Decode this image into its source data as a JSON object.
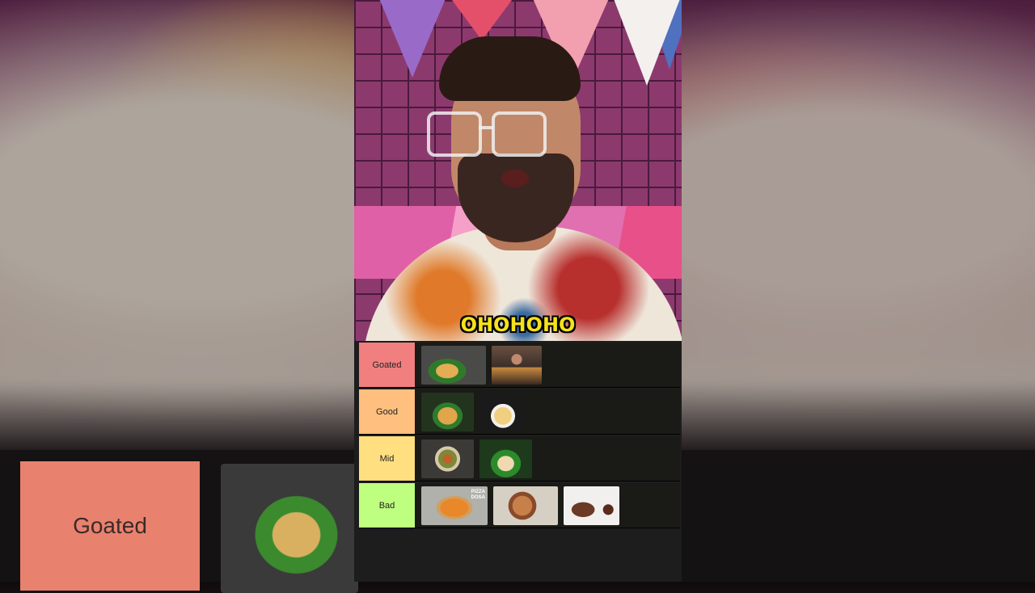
{
  "caption": "OHOHOHO",
  "background": {
    "tier_label": "Goated"
  },
  "tiers": [
    {
      "label": "Goated",
      "color": "#f27f7f",
      "items": [
        {
          "name": "masala-dosa-thumb",
          "width": 80,
          "bg": "radial-gradient(ellipse at 40% 65%, #e3ad54 0 20%, #2f7a2a 21% 34%, #4a4a48 35% 100%)"
        },
        {
          "name": "person-cooking-thumb",
          "width": 62,
          "bg": "radial-gradient(circle at 50% 35%, #c08a70 0 14%, transparent 16%), linear-gradient(180deg,#6a5040 0%, #3a2e28 55%, #c88a40 56%, #3a2a20 100%)"
        }
      ]
    },
    {
      "label": "Good",
      "color": "#ffbf7f",
      "items": [
        {
          "name": "dosa-chutney-thumb",
          "width": 65,
          "bg": "radial-gradient(ellipse at 50% 60%, #e1a54a 0 26%, #2e7b2c 27% 40%, #23341e 41% 100%)"
        },
        {
          "name": "cheese-dosa-thumb",
          "width": 58,
          "bg": "radial-gradient(ellipse at 50% 60%, #f0d080 0 26%, #f4f0e8 27% 36%, #1a1a1a 37% 100%)"
        }
      ]
    },
    {
      "label": "Mid",
      "color": "#ffdf7f",
      "items": [
        {
          "name": "loaded-dosa-thumb",
          "width": 65,
          "bg": "radial-gradient(circle at 50% 50%, #c0602a 0 14%, #7a8a3a 15% 28%, #d8c8a8 29% 38%, #3c3a36 39% 100%)"
        },
        {
          "name": "uttapam-leaf-thumb",
          "width": 65,
          "bg": "radial-gradient(ellipse at 50% 62%, #f0d8b0 0 22%, #2d8a2a 23% 40%, #1e3a1c 41% 100%)"
        }
      ]
    },
    {
      "label": "Bad",
      "color": "#bfff7f",
      "items": [
        {
          "name": "pizza-dosa-thumb",
          "width": 82,
          "bg": "radial-gradient(ellipse at 50% 55%, #e8882a 0 30%, #d0a060 31% 38%, #b0b0ac 39% 100%)",
          "overlay": "PIZZA\nDOSA"
        },
        {
          "name": "noodle-dosa-thumb",
          "width": 80,
          "bg": "radial-gradient(circle at 45% 50%, #c8804a 0 24%, #8a4a2a 25% 34%, #d6cfc4 35% 100%)"
        },
        {
          "name": "chocolate-dosa-thumb",
          "width": 69,
          "bg": "radial-gradient(ellipse at 35% 60%, #6a3a24 0 22%, transparent 23%), radial-gradient(circle at 80% 60%, #5a2a1a 0 10%, transparent 11%), #f2f0ee"
        }
      ]
    }
  ]
}
